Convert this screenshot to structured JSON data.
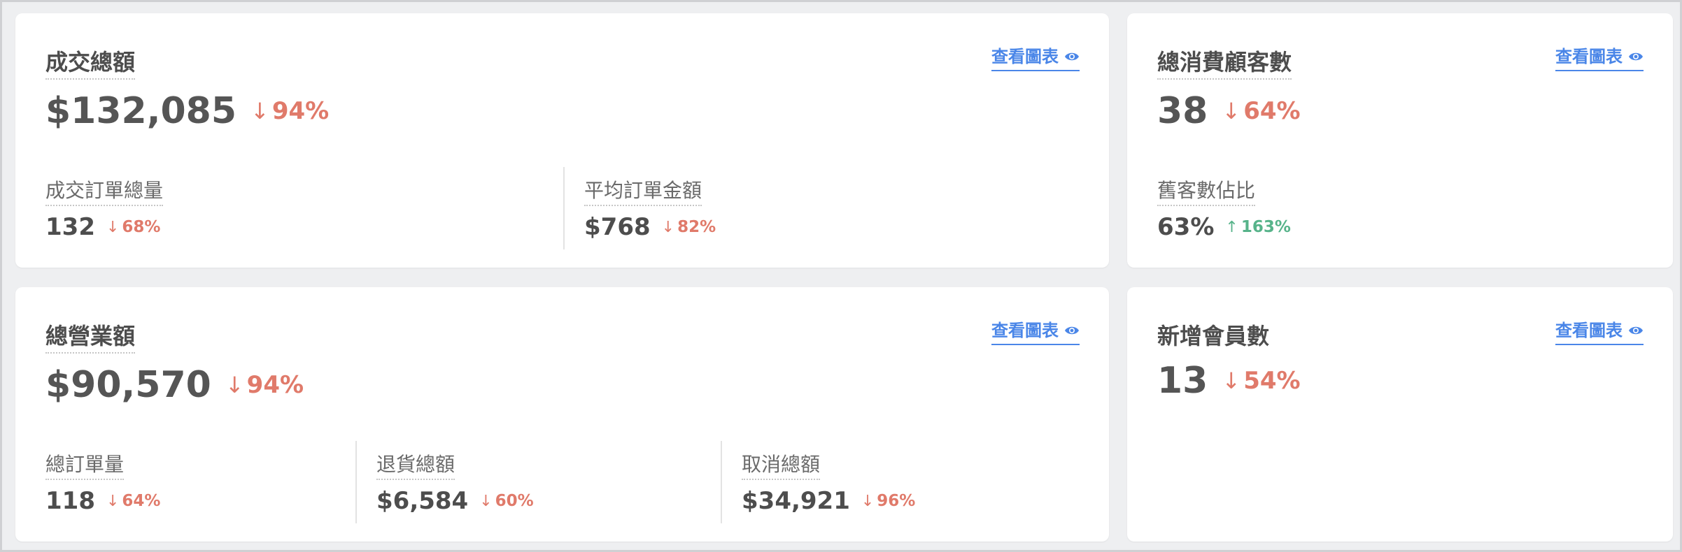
{
  "view_chart_label": "查看圖表",
  "revenue": {
    "title": "成交總額",
    "value": "$132,085",
    "change": "94%",
    "change_arrow": "↓",
    "subs": [
      {
        "label": "成交訂單總量",
        "value": "132",
        "change": "68%",
        "arrow": "↓"
      },
      {
        "label": "平均訂單金額",
        "value": "$768",
        "change": "82%",
        "arrow": "↓"
      }
    ]
  },
  "customers": {
    "title": "總消費顧客數",
    "value": "38",
    "change": "64%",
    "change_arrow": "↓",
    "subs": [
      {
        "label": "舊客數佔比",
        "value": "63%",
        "change": "163%",
        "arrow": "↑"
      }
    ]
  },
  "sales": {
    "title": "總營業額",
    "value": "$90,570",
    "change": "94%",
    "change_arrow": "↓",
    "subs": [
      {
        "label": "總訂單量",
        "value": "118",
        "change": "64%",
        "arrow": "↓"
      },
      {
        "label": "退貨總額",
        "value": "$6,584",
        "change": "60%",
        "arrow": "↓"
      },
      {
        "label": "取消總額",
        "value": "$34,921",
        "change": "96%",
        "arrow": "↓"
      }
    ]
  },
  "members": {
    "title": "新增會員數",
    "value": "13",
    "change": "54%",
    "change_arrow": "↓"
  },
  "colors": {
    "down": "#e07a6a",
    "up": "#57b38a",
    "link": "#4a86e8"
  },
  "icons": {
    "view": "eye-icon",
    "down": "arrow-down-icon",
    "up": "arrow-up-icon"
  }
}
